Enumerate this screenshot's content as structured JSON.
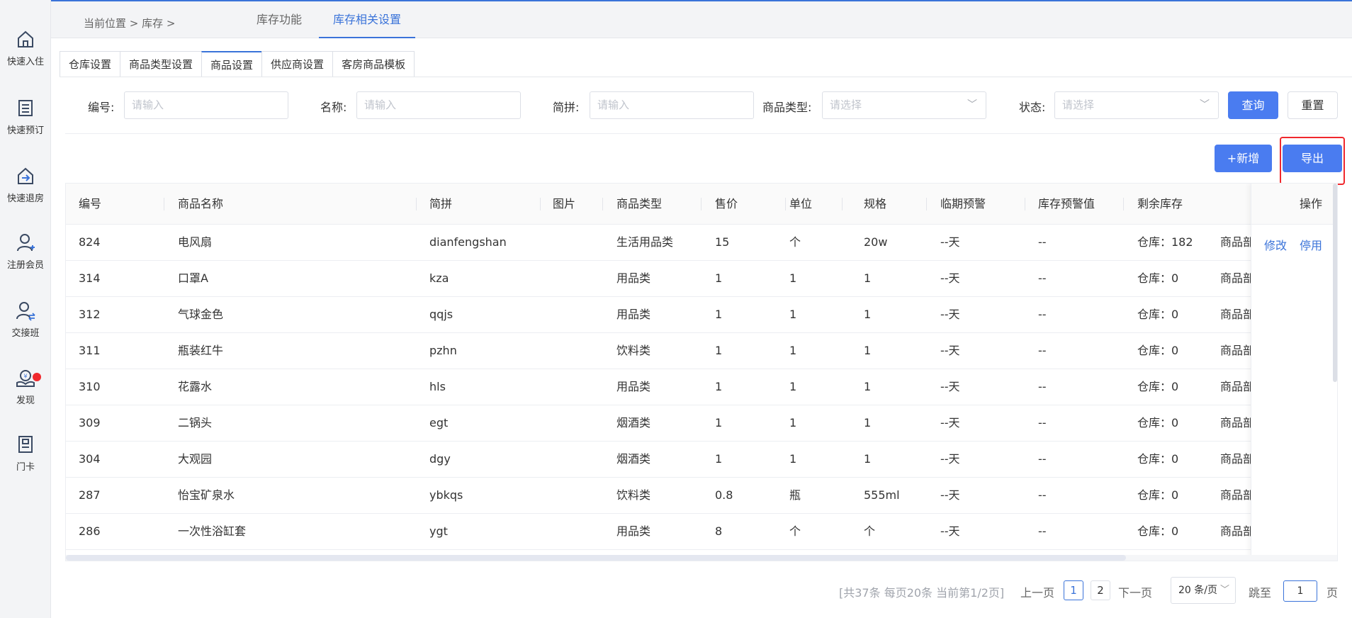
{
  "sidebar": {
    "items": [
      {
        "label": "快速入住",
        "icon": "home-icon"
      },
      {
        "label": "快速预订",
        "icon": "list-icon"
      },
      {
        "label": "快速退房",
        "icon": "checkout-icon"
      },
      {
        "label": "注册会员",
        "icon": "add-user-icon"
      },
      {
        "label": "交接班",
        "icon": "shift-icon"
      },
      {
        "label": "发现",
        "icon": "discover-icon"
      },
      {
        "label": "门卡",
        "icon": "card-icon"
      }
    ]
  },
  "header": {
    "breadcrumb": "当前位置 > 库存 >",
    "tabs": [
      "库存功能",
      "库存相关设置"
    ],
    "active_tab": "库存相关设置"
  },
  "subtabs": [
    "仓库设置",
    "商品类型设置",
    "商品设置",
    "供应商设置",
    "客房商品模板"
  ],
  "active_subtab": "商品设置",
  "filters": {
    "code_label": "编号:",
    "code_placeholder": "请输入",
    "name_label": "名称:",
    "name_placeholder": "请输入",
    "pinyin_label": "简拼:",
    "pinyin_placeholder": "请输入",
    "type_label": "商品类型:",
    "type_placeholder": "请选择",
    "status_label": "状态:",
    "status_placeholder": "请选择",
    "query_label": "查询",
    "reset_label": "重置"
  },
  "actions": {
    "add_label": "+新增",
    "export_label": "导出"
  },
  "table": {
    "columns": [
      "编号",
      "商品名称",
      "简拼",
      "图片",
      "商品类型",
      "售价",
      "单位",
      "规格",
      "临期预警",
      "库存预警值",
      "剩余库存",
      "操作"
    ],
    "rows": [
      {
        "id": "824",
        "name": "电风扇",
        "pinyin": "dianfengshan",
        "type": "生活用品类",
        "price": "15",
        "unit": "个",
        "spec": "20w",
        "expiry": "--天",
        "warn": "--",
        "stock": "仓库：182",
        "extra": "商品部"
      },
      {
        "id": "314",
        "name": "口罩A",
        "pinyin": "kza",
        "type": "用品类",
        "price": "1",
        "unit": "1",
        "spec": "1",
        "expiry": "--天",
        "warn": "--",
        "stock": "仓库：0",
        "extra": "商品部"
      },
      {
        "id": "312",
        "name": "气球金色",
        "pinyin": "qqjs",
        "type": "用品类",
        "price": "1",
        "unit": "1",
        "spec": "1",
        "expiry": "--天",
        "warn": "--",
        "stock": "仓库：0",
        "extra": "商品部"
      },
      {
        "id": "311",
        "name": "瓶装红牛",
        "pinyin": "pzhn",
        "type": "饮料类",
        "price": "1",
        "unit": "1",
        "spec": "1",
        "expiry": "--天",
        "warn": "--",
        "stock": "仓库：0",
        "extra": "商品部"
      },
      {
        "id": "310",
        "name": "花露水",
        "pinyin": "hls",
        "type": "用品类",
        "price": "1",
        "unit": "1",
        "spec": "1",
        "expiry": "--天",
        "warn": "--",
        "stock": "仓库：0",
        "extra": "商品部"
      },
      {
        "id": "309",
        "name": "二锅头",
        "pinyin": "egt",
        "type": "烟酒类",
        "price": "1",
        "unit": "1",
        "spec": "1",
        "expiry": "--天",
        "warn": "--",
        "stock": "仓库：0",
        "extra": "商品部"
      },
      {
        "id": "304",
        "name": "大观园",
        "pinyin": "dgy",
        "type": "烟酒类",
        "price": "1",
        "unit": "1",
        "spec": "1",
        "expiry": "--天",
        "warn": "--",
        "stock": "仓库：0",
        "extra": "商品部"
      },
      {
        "id": "287",
        "name": "怡宝矿泉水",
        "pinyin": "ybkqs",
        "type": "饮料类",
        "price": "0.8",
        "unit": "瓶",
        "spec": "555ml",
        "expiry": "--天",
        "warn": "--",
        "stock": "仓库：0",
        "extra": "商品部"
      },
      {
        "id": "286",
        "name": "一次性浴缸套",
        "pinyin": "ygt",
        "type": "用品类",
        "price": "8",
        "unit": "个",
        "spec": "个",
        "expiry": "--天",
        "warn": "--",
        "stock": "仓库：0",
        "extra": "商品部"
      }
    ],
    "op_edit": "修改",
    "op_disable": "停用"
  },
  "pagination": {
    "info": "[共37条 每页20条 当前第1/2页]",
    "prev": "上一页",
    "pages": [
      "1",
      "2"
    ],
    "current": "1",
    "next": "下一页",
    "page_size": "20 条/页",
    "jump_label": "跳至",
    "jump_value": "1",
    "page_suffix": "页"
  },
  "colors": {
    "accent": "#3a73d9",
    "primary_button": "#4a7cf0",
    "highlight": "#f0282d"
  }
}
